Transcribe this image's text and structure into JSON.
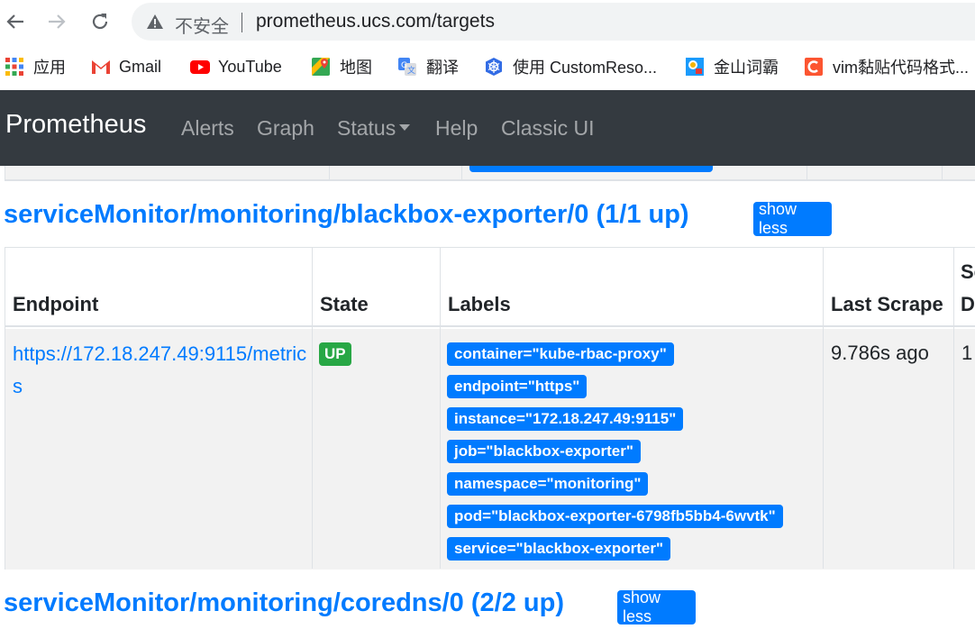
{
  "browser": {
    "insecure_label": "不安全",
    "url": "prometheus.ucs.com/targets",
    "bookmarks": [
      {
        "label": "应用",
        "icon": "apps-grid-icon"
      },
      {
        "label": "Gmail",
        "icon": "gmail-icon"
      },
      {
        "label": "YouTube",
        "icon": "youtube-icon"
      },
      {
        "label": "地图",
        "icon": "maps-icon"
      },
      {
        "label": "翻译",
        "icon": "translate-icon"
      },
      {
        "label": "使用 CustomReso...",
        "icon": "kubernetes-icon"
      },
      {
        "label": "金山词霸",
        "icon": "iciba-icon"
      },
      {
        "label": "vim黏贴代码格式...",
        "icon": "csdn-icon"
      }
    ]
  },
  "navbar": {
    "brand": "Prometheus",
    "links": [
      "Alerts",
      "Graph",
      "Status",
      "Help",
      "Classic UI"
    ]
  },
  "sections": [
    {
      "title": "serviceMonitor/monitoring/blackbox-exporter/0 (1/1 up)",
      "toggle_label": "show less",
      "columns": [
        "Endpoint",
        "State",
        "Labels",
        "Last Scrape",
        "Sc",
        "D"
      ],
      "rows": [
        {
          "endpoint": "https://172.18.247.49:9115/metrics",
          "state": "UP",
          "labels": [
            "container=\"kube-rbac-proxy\"",
            "endpoint=\"https\"",
            "instance=\"172.18.247.49:9115\"",
            "job=\"blackbox-exporter\"",
            "namespace=\"monitoring\"",
            "pod=\"blackbox-exporter-6798fb5bb4-6wvtk\"",
            "service=\"blackbox-exporter\""
          ],
          "last_scrape": "9.786s ago",
          "scrape_duration_partial": "1"
        }
      ]
    },
    {
      "title": "serviceMonitor/monitoring/coredns/0 (2/2 up)",
      "toggle_label": "show less"
    }
  ],
  "colors": {
    "navbar_bg": "#343a40",
    "link_blue": "#007bff",
    "success_green": "#28a745",
    "row_stripe": "#f2f2f2"
  }
}
